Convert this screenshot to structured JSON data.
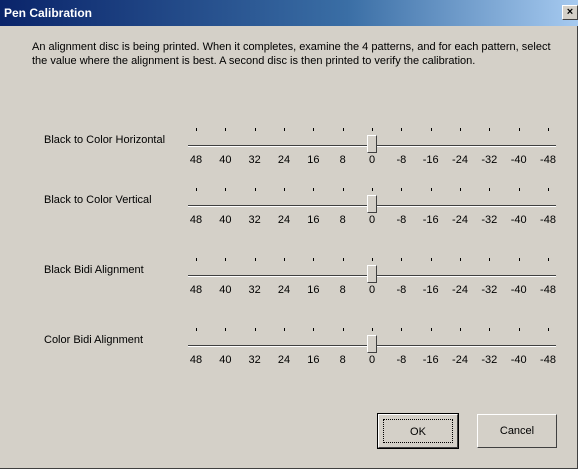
{
  "window": {
    "title": "Pen Calibration",
    "close_glyph": "×"
  },
  "intro_text": "An alignment disc is being printed. When it completes, examine the 4 patterns, and for each pattern, select the value where the alignment is best.  A second disc is then printed to verify the calibration.",
  "scale_labels": [
    "48",
    "40",
    "32",
    "24",
    "16",
    "8",
    "0",
    "-8",
    "-16",
    "-24",
    "-32",
    "-40",
    "-48"
  ],
  "sliders": [
    {
      "label": "Black to Color Horizontal",
      "value": 0
    },
    {
      "label": "Black to Color Vertical",
      "value": 0
    },
    {
      "label": "Black Bidi Alignment",
      "value": 0
    },
    {
      "label": "Color Bidi Alignment",
      "value": 0
    }
  ],
  "buttons": {
    "ok_label": "OK",
    "cancel_label": "Cancel"
  },
  "colors": {
    "titlebar_start": "#0a246a",
    "titlebar_end": "#a6caf0",
    "dialog_face": "#d4d0c8"
  }
}
